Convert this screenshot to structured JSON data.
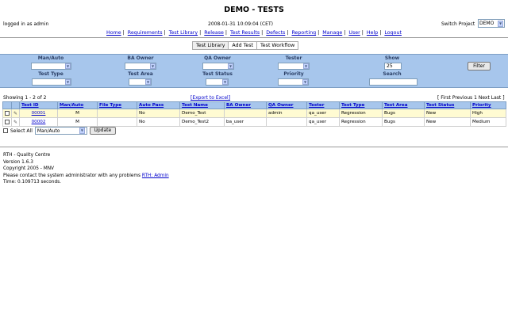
{
  "page": {
    "title": "DEMO - TESTS"
  },
  "header": {
    "login_text": "logged in as admin",
    "datetime": "2008-01-31 10:09:04 (CET)",
    "switch_label": "Switch Project",
    "project_value": "DEMO"
  },
  "nav": {
    "items": [
      "Home",
      "Requirements",
      "Test Library",
      "Release",
      "Test Results",
      "Defects",
      "Reporting",
      "Manage",
      "User",
      "Help",
      "Logout"
    ]
  },
  "subnav": {
    "items": [
      "Test Library",
      "Add Test",
      "Test Workflow"
    ]
  },
  "filters": {
    "man_auto": "Man/Auto",
    "ba_owner": "BA Owner",
    "qa_owner": "QA Owner",
    "tester": "Tester",
    "show": "Show",
    "test_type": "Test Type",
    "test_area": "Test Area",
    "test_status": "Test Status",
    "priority": "Priority",
    "search": "Search",
    "show_value": "25",
    "filter_button": "Filter"
  },
  "results": {
    "showing": "Showing 1 - 2 of 2",
    "export": "[Export to Excel]",
    "pager": {
      "open": "[",
      "first": "First",
      "previous": "Previous",
      "page": "1",
      "next": "Next",
      "last": "Last",
      "close": "]"
    },
    "columns": [
      "Test ID",
      "Man/Auto",
      "File Type",
      "Auto Pass",
      "Test Name",
      "BA Owner",
      "QA Owner",
      "Tester",
      "Test Type",
      "Test Area",
      "Test Status",
      "Priority"
    ],
    "rows": [
      {
        "id": "00001",
        "man_auto": "M",
        "file_type": "",
        "auto_pass": "No",
        "name": "Demo_Test",
        "ba_owner": "",
        "qa_owner": "admin",
        "tester": "qa_user",
        "type": "Regression",
        "area": "Bugs",
        "status": "New",
        "priority": "High"
      },
      {
        "id": "00002",
        "man_auto": "M",
        "file_type": "",
        "auto_pass": "No",
        "name": "Demo_Test2",
        "ba_owner": "ba_user",
        "qa_owner": "",
        "tester": "qa_user",
        "type": "Regression",
        "area": "Bugs",
        "status": "New",
        "priority": "Medium"
      }
    ]
  },
  "bulk": {
    "select_all": "Select All",
    "action_value": "Man/Auto",
    "update_button": "Update"
  },
  "footer": {
    "line1": "RTH - Quality Centre",
    "line2": "Version 1.6.3",
    "line3": "Copyright 2005 - MNV",
    "line4_prefix": "Please contact the system administrator with any problems ",
    "line4_link": "RTH: Admin",
    "line5": "Time: 0.109713 seconds."
  },
  "colors": {
    "filter_bg": "#a7c6ec",
    "row_highlight": "#fffbd2",
    "link": "#0000cc"
  }
}
